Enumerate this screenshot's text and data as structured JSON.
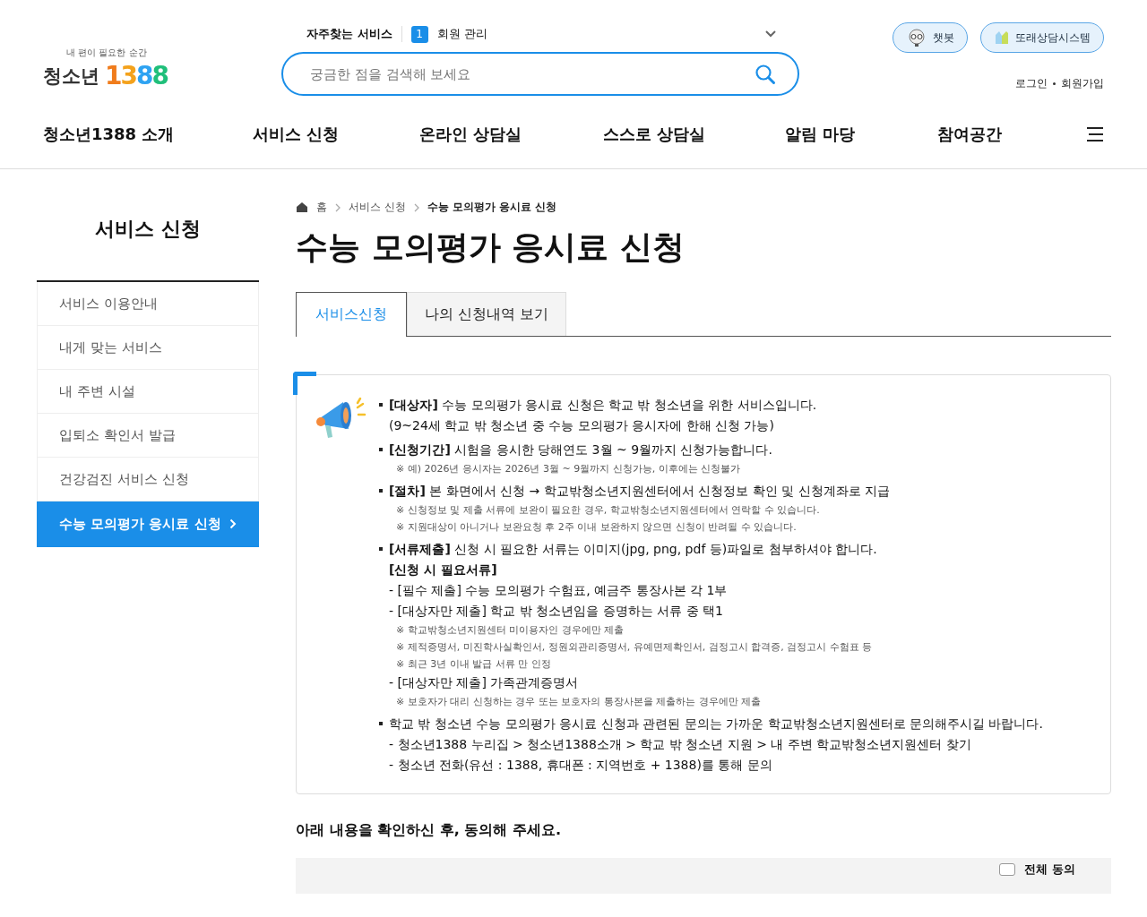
{
  "logo": {
    "tagline": "내 편이 필요한 순간",
    "name": "청소년",
    "number": "1388"
  },
  "quick": {
    "label": "자주찾는 서비스",
    "rank": "1",
    "item": "회원 관리"
  },
  "search": {
    "placeholder": "궁금한 점을 검색해 보세요"
  },
  "top_buttons": [
    {
      "kind": "chatbot",
      "label": "챗봇"
    },
    {
      "kind": "peer",
      "label": "또래상담시스템"
    }
  ],
  "account_links": [
    "로그인",
    "회원가입"
  ],
  "nav": [
    "청소년1388 소개",
    "서비스 신청",
    "온라인 상담실",
    "스스로 상담실",
    "알림 마당",
    "참여공간"
  ],
  "sidebar": {
    "title": "서비스 신청",
    "items": [
      {
        "label": "서비스 이용안내",
        "selected": false
      },
      {
        "label": "내게 맞는 서비스",
        "selected": false
      },
      {
        "label": "내 주변 시설",
        "selected": false
      },
      {
        "label": "입퇴소 확인서 발급",
        "selected": false
      },
      {
        "label": "건강검진 서비스 신청",
        "selected": false
      },
      {
        "label": "수능 모의평가 응시료 신청",
        "selected": true
      }
    ]
  },
  "breadcrumb": [
    "홈",
    "서비스 신청",
    "수능 모의평가 응시료 신청"
  ],
  "page_title": "수능 모의평가 응시료 신청",
  "tabs": [
    {
      "label": "서비스신청",
      "selected": true
    },
    {
      "label": "나의 신청내역 보기",
      "selected": false
    }
  ],
  "notice": [
    {
      "lines": [
        {
          "kind": "main",
          "text": "**[대상자]** 수능 모의평가 응시료 신청은 학교 밖 청소년을 위한 서비스입니다."
        },
        {
          "kind": "cont",
          "text": "(9~24세 학교 밖 청소년 중 수능 모의평가 응시자에 한해 신청 가능)"
        }
      ]
    },
    {
      "lines": [
        {
          "kind": "main",
          "text": "**[신청기간]** 시험을 응시한 당해연도 3월 ~ 9월까지 신청가능합니다."
        },
        {
          "kind": "note",
          "text": "※ 예) 2026년 응시자는 2026년 3월 ~ 9월까지 신청가능, 이후에는 신청불가"
        }
      ]
    },
    {
      "lines": [
        {
          "kind": "main",
          "text": "**[절차]** 본 화면에서 신청 → 학교밖청소년지원센터에서 신청정보 확인 및 신청계좌로 지급"
        },
        {
          "kind": "note",
          "text": "※ 신청정보 및 제출 서류에 보완이 필요한 경우, 학교밖청소년지원센터에서 연락할 수 있습니다."
        },
        {
          "kind": "note",
          "text": "※ 지원대상이 아니거나 보완요청 후 2주 이내 보완하지 않으면 신청이 반려될 수 있습니다."
        }
      ]
    },
    {
      "lines": [
        {
          "kind": "main",
          "text": "**[서류제출]** 신청 시 필요한 서류는 이미지(jpg, png, pdf 등)파일로 첨부하셔야 합니다."
        },
        {
          "kind": "heading",
          "text": "[신청 시 필요서류]"
        },
        {
          "kind": "cont",
          "text": "- [필수 제출] 수능 모의평가 수험표, 예금주 통장사본 각 1부"
        },
        {
          "kind": "cont",
          "text": "- [대상자만 제출] 학교 밖 청소년임을 증명하는 서류 중 택1"
        },
        {
          "kind": "note",
          "text": "※ 학교밖청소년지원센터 미이용자인 경우에만 제출"
        },
        {
          "kind": "note",
          "text": "※ 제적증명서, 미진학사실확인서, 정원외관리증명서, 유예면제확인서, 검정고시 합격증, 검정고시 수험표 등"
        },
        {
          "kind": "note",
          "text": "※ 최근 3년 이내 발급 서류 만 인정"
        },
        {
          "kind": "cont",
          "text": "- [대상자만 제출] 가족관계증명서"
        },
        {
          "kind": "note",
          "text": "※ 보호자가 대리 신청하는 경우 또는 보호자의 통장사본을 제출하는 경우에만 제출"
        }
      ]
    },
    {
      "lines": [
        {
          "kind": "main",
          "text": "학교 밖 청소년 수능 모의평가 응시료 신청과 관련된 문의는 가까운 학교밖청소년지원센터로 문의해주시길 바랍니다."
        },
        {
          "kind": "cont",
          "text": "- 청소년1388 누리집 > 청소년1388소개 > 학교 밖 청소년 지원 > 내 주변 학교밖청소년지원센터 찾기"
        },
        {
          "kind": "cont",
          "text": "- 청소년 전화(유선 : 1388, 휴대폰 : 지역번호 + 1388)를 통해 문의"
        }
      ]
    }
  ],
  "agree": {
    "prompt": "아래 내용을 확인하신 후, 동의해 주세요.",
    "all_label": "전체 동의",
    "checked": false
  }
}
